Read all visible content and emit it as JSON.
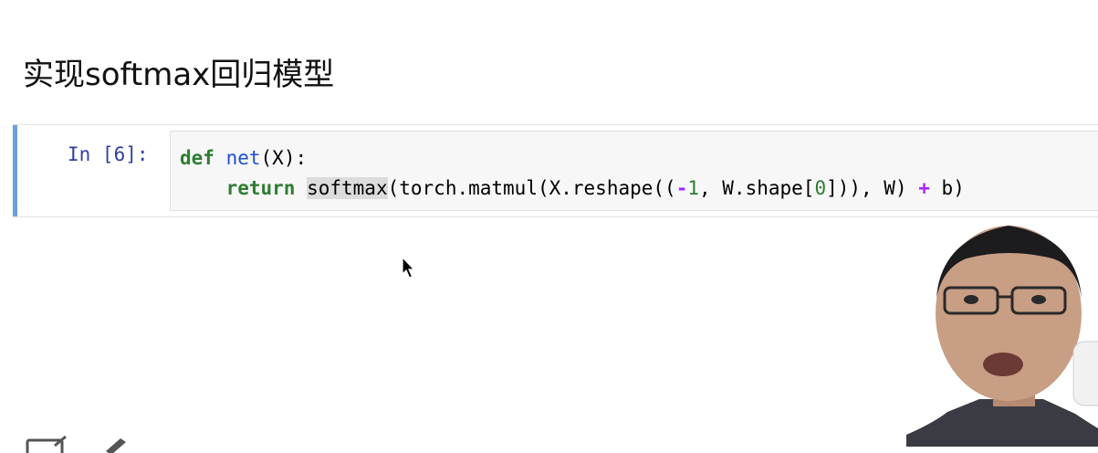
{
  "heading": "实现softmax回归模型",
  "cell": {
    "prompt": "In [6]:",
    "line1": {
      "kw_def": "def",
      "fname": "net",
      "rest": "(X):"
    },
    "line2": {
      "indent": "    ",
      "kw_return": "return",
      "space": " ",
      "softmax": "softmax",
      "part1": "(torch.matmul(X.reshape((",
      "minus": "-",
      "one": "1",
      "part2": ", W.shape[",
      "zero": "0",
      "part3": "])), W) ",
      "plus": "+",
      "part4": " b)"
    }
  },
  "colors": {
    "accent_bar": "#66a3dc",
    "keyword": "#2e7d32",
    "function_name": "#1e4fd1",
    "operator": "#aa22ff",
    "prompt": "#303f9f"
  },
  "icons": [
    "cursor-arrow-icon",
    "edit-icon",
    "pen-icon"
  ]
}
